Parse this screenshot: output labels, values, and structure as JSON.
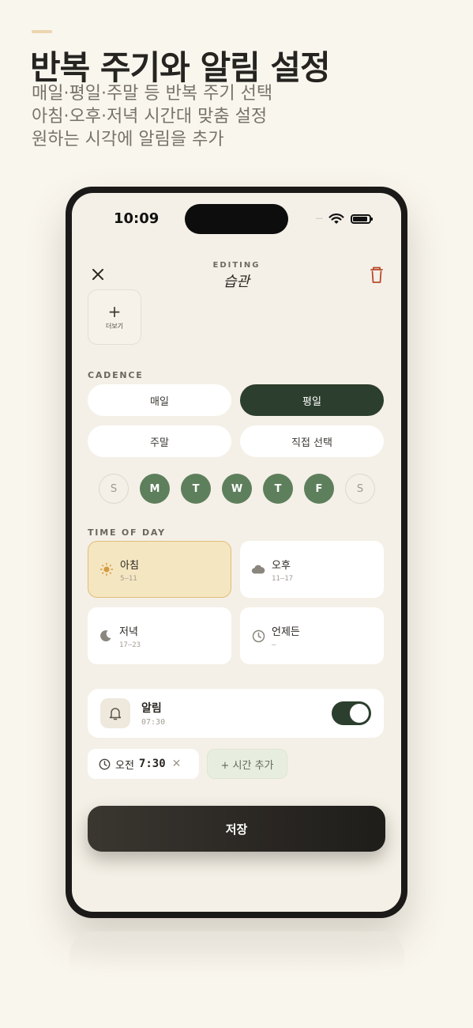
{
  "promo": {
    "headline": "반복 주기와 알림 설정",
    "subs": [
      "매일·평일·주말 등 반복 주기 선택",
      "아침·오후·저녁 시간대 맞춤 설정",
      "원하는 시각에 알림을 추가"
    ]
  },
  "status_bar": {
    "time": "10:09",
    "signal": "····"
  },
  "nav": {
    "eyebrow": "EDITING",
    "title": "습관",
    "close_icon": "close-icon",
    "delete_icon": "trash-icon"
  },
  "more_tile": {
    "label": "더보기"
  },
  "cadence": {
    "label": "CADENCE",
    "options": [
      "매일",
      "평일",
      "주말",
      "직접 선택"
    ],
    "selected": "평일",
    "days": [
      "S",
      "M",
      "T",
      "W",
      "T",
      "F",
      "S"
    ],
    "days_on": [
      false,
      true,
      true,
      true,
      true,
      true,
      false
    ]
  },
  "time_of_day": {
    "label": "TIME OF DAY",
    "options": [
      {
        "name": "아침",
        "range": "5–11",
        "icon": "sun-icon"
      },
      {
        "name": "오후",
        "range": "11–17",
        "icon": "cloud-icon"
      },
      {
        "name": "저녁",
        "range": "17–23",
        "icon": "moon-icon"
      },
      {
        "name": "언제든",
        "range": "–",
        "icon": "clock-icon"
      }
    ],
    "selected": "아침"
  },
  "alarm": {
    "title": "알림",
    "time": "07:30",
    "enabled": true
  },
  "alarm_times": {
    "meridiem": "오전",
    "time": "7:30",
    "add_label": "+ 시간 추가"
  },
  "save_label": "저장",
  "colors": {
    "accent": "#2c3e2d",
    "day_on": "#5e7f5c",
    "morning_fill": "#f5e6c2",
    "delete": "#b8492a",
    "background": "#f4f0e7"
  }
}
